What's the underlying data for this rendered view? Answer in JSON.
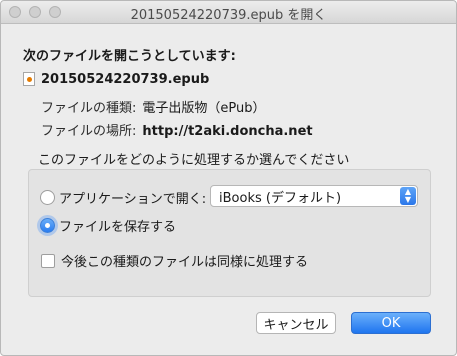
{
  "window": {
    "title": "20150524220739.epub を開く"
  },
  "dialog": {
    "heading": "次のファイルを開こうとしています:",
    "file_name": "20150524220739.epub",
    "type_label": "ファイルの種類:",
    "type_value": "電子出版物（ePub）",
    "location_label": "ファイルの場所:",
    "location_value": "http://t2aki.doncha.net",
    "question": "このファイルをどのように処理するか選んでください",
    "open_with_label": "アプリケーションで開く:",
    "open_with_app": "iBooks (デフォルト)",
    "save_file_label": "ファイルを保存する",
    "remember_label": "今後この種類のファイルは同様に処理する",
    "cancel_label": "キャンセル",
    "ok_label": "OK"
  },
  "colors": {
    "accent": "#2a7cf0"
  }
}
